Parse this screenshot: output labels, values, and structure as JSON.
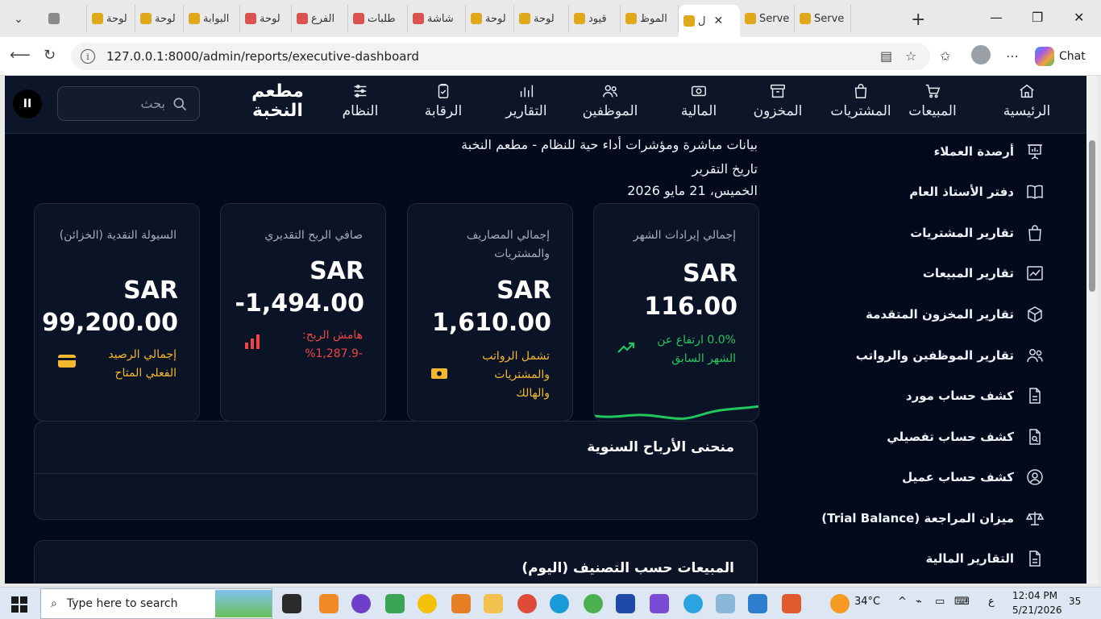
{
  "browser": {
    "tabs": [
      {
        "label": "",
        "color": "#8a8a8a"
      },
      {
        "label": "لوحة",
        "color": "#e0a91b"
      },
      {
        "label": "لوحة",
        "color": "#e0a91b"
      },
      {
        "label": "البوابة",
        "color": "#e0a91b"
      },
      {
        "label": "لوحة",
        "color": "#d9534f"
      },
      {
        "label": "الفرع",
        "color": "#d9534f"
      },
      {
        "label": "طلبات",
        "color": "#d9534f"
      },
      {
        "label": "شاشة",
        "color": "#d9534f"
      },
      {
        "label": "لوحة",
        "color": "#e0a91b"
      },
      {
        "label": "لوحة",
        "color": "#e0a91b"
      },
      {
        "label": "قيود",
        "color": "#e0a91b"
      },
      {
        "label": "الموظ",
        "color": "#e0a91b"
      },
      {
        "label": "ل",
        "color": "#e0a91b",
        "active": true
      },
      {
        "label": "Serve",
        "color": "#e0a91b"
      },
      {
        "label": "Serve",
        "color": "#e0a91b"
      }
    ],
    "url": "127.0.0.1:8000/admin/reports/executive-dashboard",
    "chat_label": "Chat"
  },
  "app": {
    "brand": "مطعم النخبة",
    "search_placeholder": "بحث",
    "nav": [
      {
        "label": "الرئيسية",
        "icon": "home-icon"
      },
      {
        "label": "المبيعات",
        "icon": "cart-icon"
      },
      {
        "label": "المشتريات",
        "icon": "bag-icon"
      },
      {
        "label": "المخزون",
        "icon": "box-icon"
      },
      {
        "label": "المالية",
        "icon": "money-icon"
      },
      {
        "label": "الموظفين",
        "icon": "users-icon"
      },
      {
        "label": "التقارير",
        "icon": "chart-icon"
      },
      {
        "label": "الرقابة",
        "icon": "clipboard-icon"
      },
      {
        "label": "النظام",
        "icon": "sliders-icon"
      }
    ],
    "sidebar": [
      {
        "label": "أرصدة العملاء",
        "icon": "presentation-icon"
      },
      {
        "label": "دفتر الأستاذ العام",
        "icon": "book-icon"
      },
      {
        "label": "تقارير المشتريات",
        "icon": "bag-icon"
      },
      {
        "label": "تقارير المبيعات",
        "icon": "trend-icon"
      },
      {
        "label": "تقارير المخزون المتقدمة",
        "icon": "cube-icon"
      },
      {
        "label": "تقارير الموظفين والرواتب",
        "icon": "users-icon"
      },
      {
        "label": "كشف حساب مورد",
        "icon": "file-icon"
      },
      {
        "label": "كشف حساب تفصيلي",
        "icon": "file-search-icon"
      },
      {
        "label": "كشف حساب عميل",
        "icon": "user-circle-icon"
      },
      {
        "label": "ميزان المراجعة (Trial Balance)",
        "icon": "scale-icon"
      },
      {
        "label": "التقارير المالية",
        "icon": "file-icon"
      }
    ],
    "header": {
      "subtitle": "بيانات مباشرة ومؤشرات أداء حية للنظام - مطعم النخبة",
      "report_date_label": "تاريخ التقرير",
      "report_date": "الخميس، 21 مايو 2026"
    },
    "cards": [
      {
        "label": "إجمالي إيرادات الشهر",
        "currency": "SAR",
        "value": "116.00",
        "note": "0.0% ارتفاع عن الشهر السابق",
        "note_color": "#22c55e",
        "icon": "trending-up-icon"
      },
      {
        "label": "إجمالي المصاريف والمشتريات",
        "currency": "SAR",
        "value": "1,610.00",
        "note": "تشمل الرواتب والمشتريات والهالك",
        "note_color": "#f5b72d",
        "icon": "money-icon"
      },
      {
        "label": "صافي الربح التقديري",
        "currency": "SAR",
        "value": "-1,494.00",
        "note": "هامش الربح: -1,287.9%",
        "note_color": "#ef4444",
        "icon": "bar-chart-icon"
      },
      {
        "label": "السيولة النقدية (الخزائن)",
        "currency": "SAR",
        "value": "99,200.00",
        "note": "إجمالي الرصيد الفعلي المتاح",
        "note_color": "#f5b72d",
        "icon": "wallet-icon"
      }
    ],
    "panels": {
      "annual_profit_title": "منحنى الأرباح السنوية",
      "sales_by_category_title": "المبيعات حسب التصنيف (اليوم)"
    }
  },
  "taskbar": {
    "search_placeholder": "Type here to search",
    "weather": "34°C",
    "time": "12:04 PM",
    "date": "5/21/2026",
    "lang": "ع",
    "notifications": "35"
  }
}
